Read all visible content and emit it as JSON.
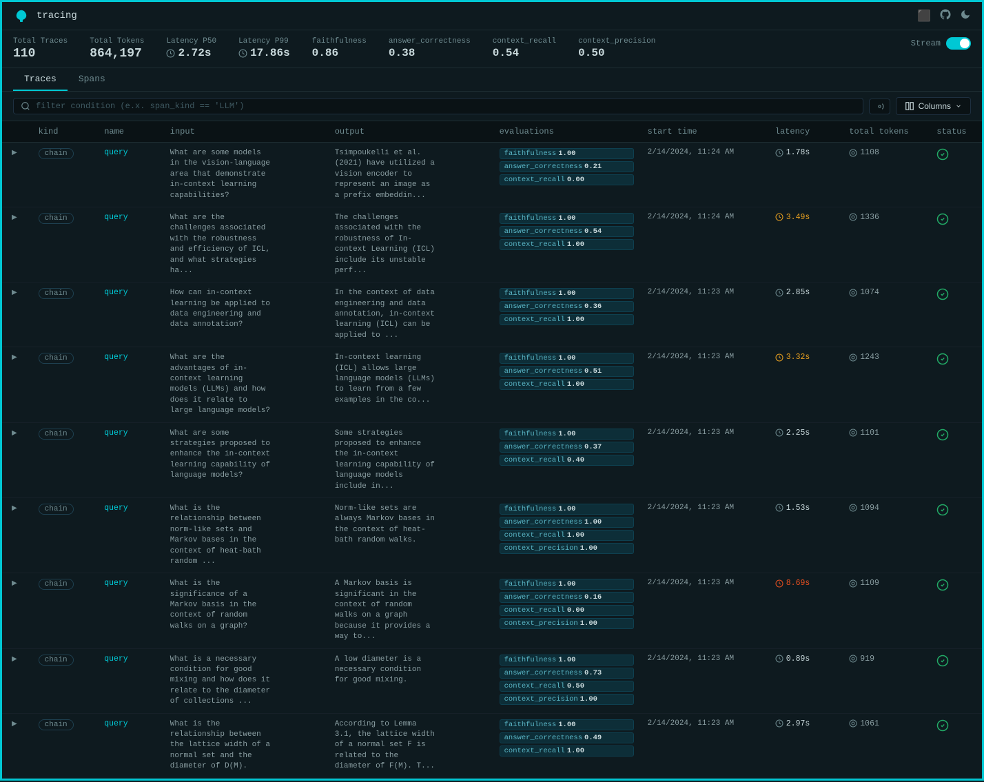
{
  "app": {
    "title": "tracing",
    "logo": "🐦"
  },
  "topbar_icons": [
    "⬛",
    "⭕",
    "🌙"
  ],
  "stats": {
    "total_traces_label": "Total Traces",
    "total_traces_value": "110",
    "total_tokens_label": "Total Tokens",
    "total_tokens_value": "864,197",
    "latency_p50_label": "Latency P50",
    "latency_p50_value": "2.72s",
    "latency_p99_label": "Latency P99",
    "latency_p99_value": "17.86s",
    "faithfulness_label": "faithfulness",
    "faithfulness_value": "0.86",
    "answer_correctness_label": "answer_correctness",
    "answer_correctness_value": "0.38",
    "context_recall_label": "context_recall",
    "context_recall_value": "0.54",
    "context_precision_label": "context_precision",
    "context_precision_value": "0.50",
    "stream_label": "Stream"
  },
  "tabs": {
    "traces_label": "Traces",
    "spans_label": "Spans"
  },
  "filter": {
    "placeholder": "filter condition (e.x. span_kind == 'LLM')",
    "columns_label": "Columns"
  },
  "table": {
    "headers": {
      "kind": "kind",
      "name": "name",
      "input": "input",
      "output": "output",
      "evaluations": "evaluations",
      "start_time": "start time",
      "latency": "latency",
      "total_tokens": "total tokens",
      "status": "status"
    },
    "rows": [
      {
        "kind": "chain",
        "name": "query",
        "input": "What are some models in the vision-language area that demonstrate in-context learning capabilities?",
        "output": "Tsimpoukelli et al. (2021) have utilized a vision encoder to represent an image as a prefix embeddin...",
        "evals": [
          {
            "type": "faithfulness",
            "label": "faithfulness",
            "value": "1.00"
          },
          {
            "type": "answer_correctness",
            "label": "answer_correctness",
            "value": "0.21"
          },
          {
            "type": "context_recall",
            "label": "context_recall",
            "value": "0.00"
          }
        ],
        "start_time": "2/14/2024, 11:24 AM",
        "latency": "1.78s",
        "latency_class": "normal",
        "total_tokens": "1108",
        "status": "ok"
      },
      {
        "kind": "chain",
        "name": "query",
        "input": "What are the challenges associated with the robustness and efficiency of ICL, and what strategies ha...",
        "output": "The challenges associated with the robustness of In-context Learning (ICL) include its unstable perf...",
        "evals": [
          {
            "type": "faithfulness",
            "label": "faithfulness",
            "value": "1.00"
          },
          {
            "type": "answer_correctness",
            "label": "answer_correctness",
            "value": "0.54"
          },
          {
            "type": "context_recall",
            "label": "context_recall",
            "value": "1.00"
          }
        ],
        "start_time": "2/14/2024, 11:24 AM",
        "latency": "3.49s",
        "latency_class": "warn",
        "total_tokens": "1336",
        "status": "ok"
      },
      {
        "kind": "chain",
        "name": "query",
        "input": "How can in-context learning be applied to data engineering and data annotation?",
        "output": "In the context of data engineering and data annotation, in-context learning (ICL) can be applied to ...",
        "evals": [
          {
            "type": "faithfulness",
            "label": "faithfulness",
            "value": "1.00"
          },
          {
            "type": "answer_correctness",
            "label": "answer_correctness",
            "value": "0.36"
          },
          {
            "type": "context_recall",
            "label": "context_recall",
            "value": "1.00"
          }
        ],
        "start_time": "2/14/2024, 11:23 AM",
        "latency": "2.85s",
        "latency_class": "normal",
        "total_tokens": "1074",
        "status": "ok"
      },
      {
        "kind": "chain",
        "name": "query",
        "input": "What are the advantages of in-context learning models (LLMs) and how does it relate to large language models?",
        "output": "In-context learning (ICL) allows large language models (LLMs) to learn from a few examples in the co...",
        "evals": [
          {
            "type": "faithfulness",
            "label": "faithfulness",
            "value": "1.00"
          },
          {
            "type": "answer_correctness",
            "label": "answer_correctness",
            "value": "0.51"
          },
          {
            "type": "context_recall",
            "label": "context_recall",
            "value": "1.00"
          }
        ],
        "start_time": "2/14/2024, 11:23 AM",
        "latency": "3.32s",
        "latency_class": "warn",
        "total_tokens": "1243",
        "status": "ok"
      },
      {
        "kind": "chain",
        "name": "query",
        "input": "What are some strategies proposed to enhance the in-context learning capability of language models?",
        "output": "Some strategies proposed to enhance the in-context learning capability of language models include in...",
        "evals": [
          {
            "type": "faithfulness",
            "label": "faithfulness",
            "value": "1.00"
          },
          {
            "type": "answer_correctness",
            "label": "answer_correctness",
            "value": "0.37"
          },
          {
            "type": "context_recall",
            "label": "context_recall",
            "value": "0.40"
          }
        ],
        "start_time": "2/14/2024, 11:23 AM",
        "latency": "2.25s",
        "latency_class": "normal",
        "total_tokens": "1101",
        "status": "ok"
      },
      {
        "kind": "chain",
        "name": "query",
        "input": "What is the relationship between norm-like sets and Markov bases in the context of heat-bath random ...",
        "output": "Norm-like sets are always Markov bases in the context of heat-bath random walks.",
        "evals": [
          {
            "type": "faithfulness",
            "label": "faithfulness",
            "value": "1.00"
          },
          {
            "type": "answer_correctness",
            "label": "answer_correctness",
            "value": "1.00"
          },
          {
            "type": "context_recall",
            "label": "context_recall",
            "value": "1.00"
          },
          {
            "type": "context_precision",
            "label": "context_precision",
            "value": "1.00"
          }
        ],
        "start_time": "2/14/2024, 11:23 AM",
        "latency": "1.53s",
        "latency_class": "normal",
        "total_tokens": "1094",
        "status": "ok"
      },
      {
        "kind": "chain",
        "name": "query",
        "input": "What is the significance of a Markov basis in the context of random walks on a graph?",
        "output": "A Markov basis is significant in the context of random walks on a graph because it provides a way to...",
        "evals": [
          {
            "type": "faithfulness",
            "label": "faithfulness",
            "value": "1.00"
          },
          {
            "type": "answer_correctness",
            "label": "answer_correctness",
            "value": "0.16"
          },
          {
            "type": "context_recall",
            "label": "context_recall",
            "value": "0.00"
          },
          {
            "type": "context_precision",
            "label": "context_precision",
            "value": "1.00"
          }
        ],
        "start_time": "2/14/2024, 11:23 AM",
        "latency": "8.69s",
        "latency_class": "slow",
        "total_tokens": "1109",
        "status": "ok"
      },
      {
        "kind": "chain",
        "name": "query",
        "input": "What is a necessary condition for good mixing and how does it relate to the diameter of collections ...",
        "output": "A low diameter is a necessary condition for good mixing.",
        "evals": [
          {
            "type": "faithfulness",
            "label": "faithfulness",
            "value": "1.00"
          },
          {
            "type": "answer_correctness",
            "label": "answer_correctness",
            "value": "0.73"
          },
          {
            "type": "context_recall",
            "label": "context_recall",
            "value": "0.50"
          },
          {
            "type": "context_precision",
            "label": "context_precision",
            "value": "1.00"
          }
        ],
        "start_time": "2/14/2024, 11:23 AM",
        "latency": "0.89s",
        "latency_class": "normal",
        "total_tokens": "919",
        "status": "ok"
      },
      {
        "kind": "chain",
        "name": "query",
        "input": "What is the relationship between the lattice width of a normal set and the diameter of D(M).",
        "output": "According to Lemma 3.1, the lattice width of a normal set F is related to the diameter of F(M). T...",
        "evals": [
          {
            "type": "faithfulness",
            "label": "faithfulness",
            "value": "1.00"
          },
          {
            "type": "answer_correctness",
            "label": "answer_correctness",
            "value": "0.49"
          },
          {
            "type": "context_recall",
            "label": "context_recall",
            "value": "1.00"
          }
        ],
        "start_time": "2/14/2024, 11:23 AM",
        "latency": "2.97s",
        "latency_class": "normal",
        "total_tokens": "1061",
        "status": "ok"
      }
    ]
  }
}
